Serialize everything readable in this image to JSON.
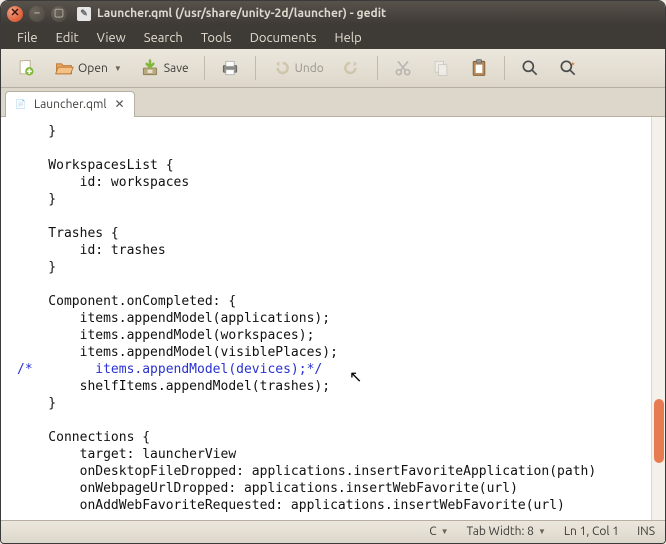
{
  "window": {
    "title": "Launcher.qml (/usr/share/unity-2d/launcher) - gedit"
  },
  "menubar": [
    "File",
    "Edit",
    "View",
    "Search",
    "Tools",
    "Documents",
    "Help"
  ],
  "toolbar": {
    "open_label": "Open",
    "save_label": "Save",
    "undo_label": "Undo"
  },
  "tab": {
    "label": "Launcher.qml"
  },
  "editor": {
    "lines": [
      "    }",
      "",
      "    WorkspacesList {",
      "        id: workspaces",
      "    }",
      "",
      "    Trashes {",
      "        id: trashes",
      "    }",
      "",
      "    Component.onCompleted: {",
      "        items.appendModel(applications);",
      "        items.appendModel(workspaces);",
      "        items.appendModel(visiblePlaces);",
      "/*        items.appendModel(devices);*/",
      "        shelfItems.appendModel(trashes);",
      "    }",
      "",
      "    Connections {",
      "        target: launcherView",
      "        onDesktopFileDropped: applications.insertFavoriteApplication(path)",
      "        onWebpageUrlDropped: applications.insertWebFavorite(url)",
      "        onAddWebFavoriteRequested: applications.insertWebFavorite(url)"
    ],
    "comment_line_index": 14
  },
  "statusbar": {
    "lang": "C",
    "tabwidth": "Tab Width: 8",
    "position": "Ln 1, Col 1",
    "mode": "INS"
  },
  "icons": {
    "close": "✕",
    "minimize": "–",
    "maximize": "▢"
  }
}
